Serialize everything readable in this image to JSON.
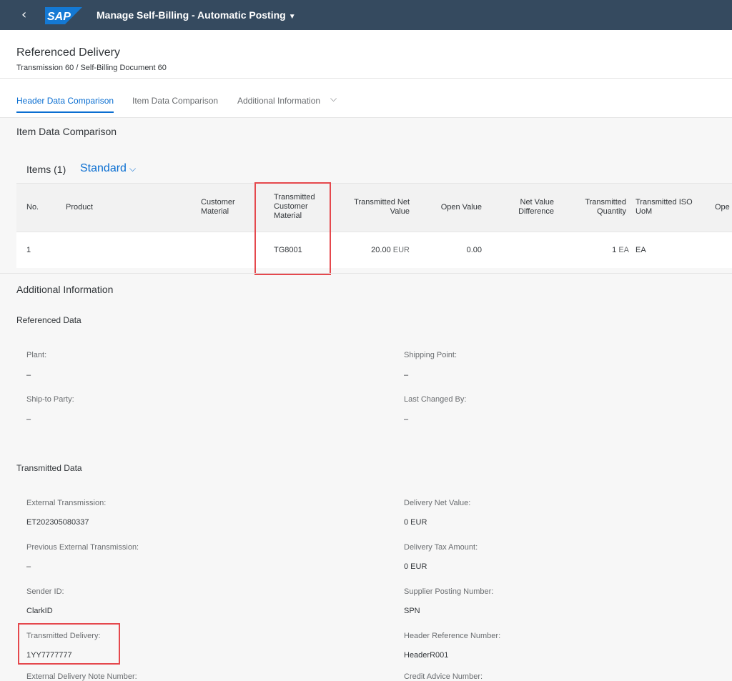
{
  "shell": {
    "back_glyph": "‹",
    "logo_text": "SAP",
    "app_title": "Manage Self-Billing - Automatic Posting",
    "title_caret": "▼"
  },
  "header": {
    "title": "Referenced Delivery",
    "subtitle": "Transmission 60 / Self-Billing Document 60"
  },
  "tabs": [
    {
      "label": "Header Data Comparison"
    },
    {
      "label": "Item Data Comparison"
    },
    {
      "label": "Additional Information"
    }
  ],
  "tab_chevron": "⌵",
  "item_section": {
    "title": "Item Data Comparison",
    "items_label": "Items (1)",
    "variant": "Standard",
    "variant_chevron": "⌵",
    "columns": [
      "No.",
      "Product",
      [
        "Customer",
        "Material"
      ],
      [
        "Transmitted",
        "Customer",
        "Material"
      ],
      [
        "Transmitted Net",
        "Value"
      ],
      "Open Value",
      [
        "Net Value",
        "Difference"
      ],
      [
        "Transmitted",
        "Quantity"
      ],
      [
        "Transmitted ISO",
        "UoM"
      ],
      "Ope"
    ],
    "row": {
      "no": "1",
      "transmitted_customer_material": "TG8001",
      "transmitted_net_value": "20.00",
      "net_value_currency": "EUR",
      "open_value": "0.00",
      "transmitted_quantity": "1",
      "quantity_unit": "EA",
      "iso_uom": "EA"
    }
  },
  "additional_info": {
    "title": "Additional Information",
    "referenced_data": {
      "title": "Referenced Data",
      "fields": [
        {
          "label": "Plant:",
          "value": "–"
        },
        {
          "label": "Shipping Point:",
          "value": "–"
        },
        {
          "label": "Ship-to Party:",
          "value": "–"
        },
        {
          "label": "Last Changed By:",
          "value": "–"
        }
      ]
    },
    "transmitted_data": {
      "title": "Transmitted Data",
      "fields": [
        {
          "label": "External Transmission:",
          "value": "ET202305080337"
        },
        {
          "label": "Delivery Net Value:",
          "value": "0 EUR"
        },
        {
          "label": "Previous External Transmission:",
          "value": "–"
        },
        {
          "label": "Delivery Tax Amount:",
          "value": "0 EUR"
        },
        {
          "label": "Sender ID:",
          "value": "ClarkID"
        },
        {
          "label": "Supplier Posting Number:",
          "value": "SPN"
        },
        {
          "label": "Transmitted Delivery:",
          "value": "1YY7777777"
        },
        {
          "label": "Header Reference Number:",
          "value": "HeaderR001"
        },
        {
          "label": "External Delivery Note Number:",
          "value": ""
        },
        {
          "label": "Credit Advice Number:",
          "value": ""
        }
      ]
    }
  },
  "colors": {
    "shell": "#354a5f",
    "accent": "#0a6ed1",
    "highlight": "#e5484d"
  }
}
